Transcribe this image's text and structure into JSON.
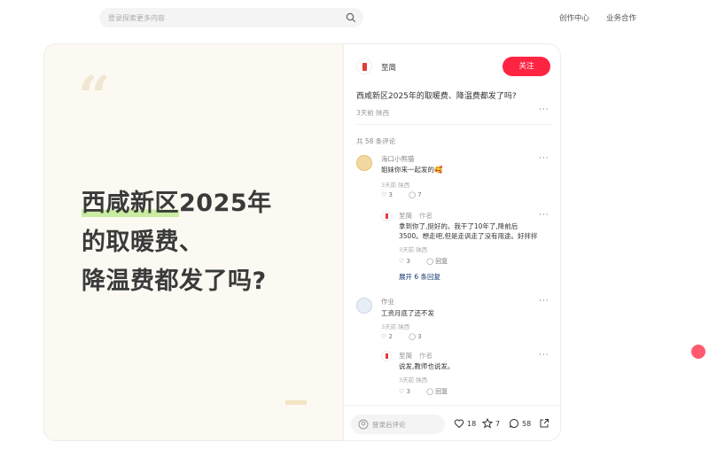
{
  "header": {
    "search_placeholder": "登录探索更多内容",
    "links": [
      "创作中心",
      "业务合作"
    ]
  },
  "cover": {
    "quote_mark": "“",
    "title_line1_highlight": "西咸新区",
    "title_line1_rest": "2025年",
    "title_line2": "的取暖费、",
    "title_line3": "降温费都发了吗?"
  },
  "post": {
    "author": "至简",
    "follow_label": "关注",
    "title": "西咸新区2025年的取暖费、降温费都发了吗?",
    "meta": "3天前 陕西",
    "comment_count": "共 58 条评论"
  },
  "comments": [
    {
      "user": "海口小熊猫",
      "text": "姐妹你来一起发的🥰",
      "meta": "3天前 陕西",
      "likes": "3",
      "replies": "7"
    },
    {
      "user": "至简",
      "author_tag": "作者",
      "text": "拿到你了,挺好的。我干了10年了,降前后3500。想走吧,但是走讽走了没有用途。好拌拌",
      "meta": "3天前 陕西",
      "likes": "3",
      "reply_label": "回复"
    },
    {
      "expand_label": "展开 6 条回复"
    },
    {
      "user": "作业",
      "text": "工资月底了还不发",
      "meta": "3天前 陕西",
      "likes": "2",
      "replies": "3"
    },
    {
      "user": "至简",
      "author_tag": "作者",
      "text": "说发,教师也说发。",
      "meta": "3天前 陕西",
      "likes": "3",
      "reply_label": "回复"
    }
  ],
  "bottom": {
    "input_placeholder": "登录后评论",
    "likes": "18",
    "collects": "7",
    "comments": "58"
  },
  "colors": {
    "accent": "#ff2442",
    "cover_bg": "#fcf9f2",
    "highlight": "#c9eca0",
    "link": "#13386c"
  }
}
